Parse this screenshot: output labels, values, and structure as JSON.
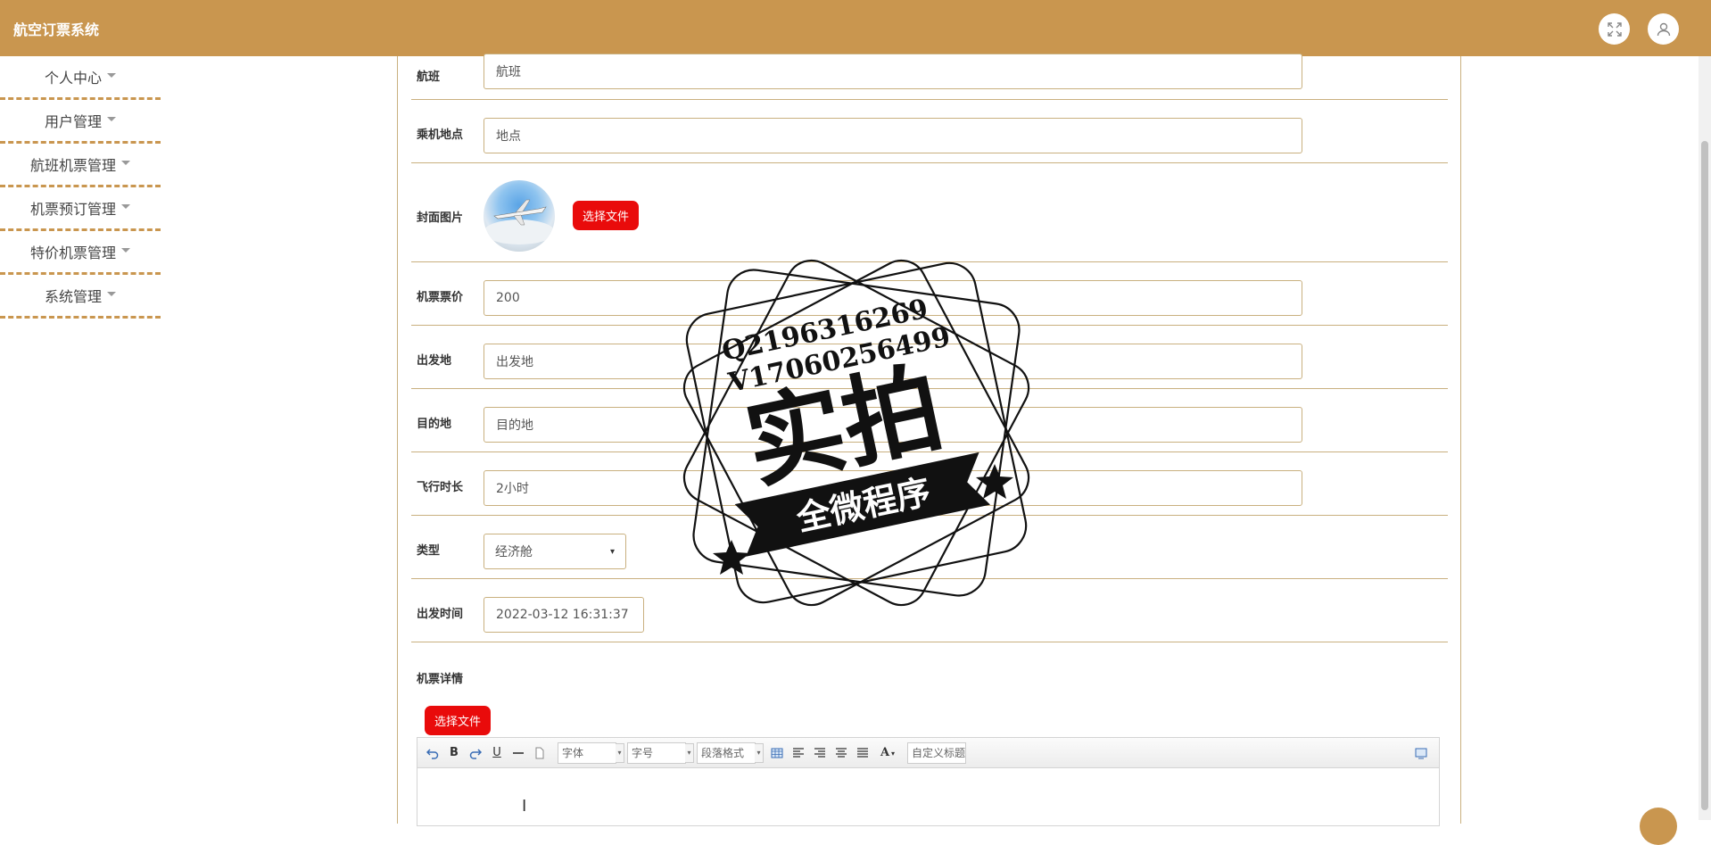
{
  "app": {
    "title": "航空订票系统"
  },
  "sidebar": {
    "items": [
      {
        "label": "个人中心"
      },
      {
        "label": "用户管理"
      },
      {
        "label": "航班机票管理"
      },
      {
        "label": "机票预订管理"
      },
      {
        "label": "特价机票管理"
      },
      {
        "label": "系统管理"
      }
    ]
  },
  "form": {
    "flight": {
      "label": "航班",
      "value": "航班"
    },
    "boarding": {
      "label": "乘机地点",
      "value": "地点"
    },
    "cover": {
      "label": "封面图片",
      "button": "选择文件"
    },
    "price": {
      "label": "机票票价",
      "value": "200"
    },
    "origin": {
      "label": "出发地",
      "value": "出发地"
    },
    "destination": {
      "label": "目的地",
      "value": "目的地"
    },
    "duration": {
      "label": "飞行时长",
      "value": "2小时"
    },
    "cabin": {
      "label": "类型",
      "value": "经济舱"
    },
    "departure": {
      "label": "出发时间",
      "value": "2022-03-12 16:31:37"
    },
    "details": {
      "label": "机票详情",
      "button": "选择文件"
    }
  },
  "editor": {
    "toolbar": {
      "font": "字体",
      "size": "字号",
      "paragraph": "段落格式",
      "custom_title": "自定义标题",
      "bold": "B",
      "underline": "U",
      "color": "A"
    }
  },
  "watermark": {
    "line1": "Q2196316269",
    "line2": "V17060256499",
    "big": "实拍",
    "banner": "全微程序"
  },
  "colors": {
    "header": "#c9964f",
    "border": "#c9b07f",
    "button": "#e90b0b"
  }
}
